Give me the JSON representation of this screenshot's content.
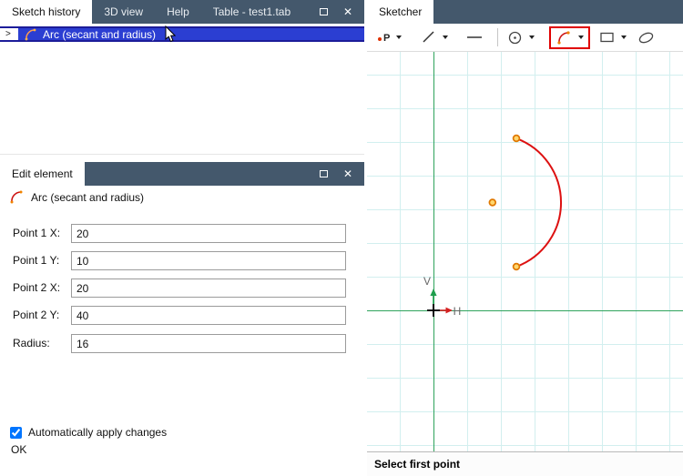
{
  "icons": {
    "close": "✕",
    "expander": ">"
  },
  "colors": {
    "tab_bar": "#44586c",
    "selection_blue": "#2b3ed2",
    "selection_border": "#1c1c99",
    "arc_red": "#dd1111",
    "marker_orange": "#e07800",
    "axis_green": "#2fa35c",
    "axis_arrow_red": "#d42020",
    "grid_cyan": "#d2efef",
    "active_tool_highlight": "#e00000"
  },
  "history_panel": {
    "tabs": [
      {
        "label": "Sketch history"
      },
      {
        "label": "3D view"
      },
      {
        "label": "Help"
      },
      {
        "label": "Table - test1.tab"
      }
    ],
    "selected_item": "Arc (secant and radius)"
  },
  "edit_panel": {
    "tab_label": "Edit element",
    "element_type": "Arc (secant and radius)",
    "fields": [
      {
        "label": "Point 1 X:",
        "value": "20"
      },
      {
        "label": "Point 1 Y:",
        "value": "10"
      },
      {
        "label": "Point 2 X:",
        "value": "20"
      },
      {
        "label": "Point 2 Y:",
        "value": "40"
      },
      {
        "label": "Radius:",
        "value": "16"
      }
    ],
    "auto_apply_label": "Automatically apply changes",
    "auto_apply_checked": true,
    "ok_label": "OK"
  },
  "sketcher": {
    "tab_label": "Sketcher",
    "point_letter": "P",
    "v_axis_label": "V",
    "h_axis_label": "H",
    "status": "Select first point"
  }
}
